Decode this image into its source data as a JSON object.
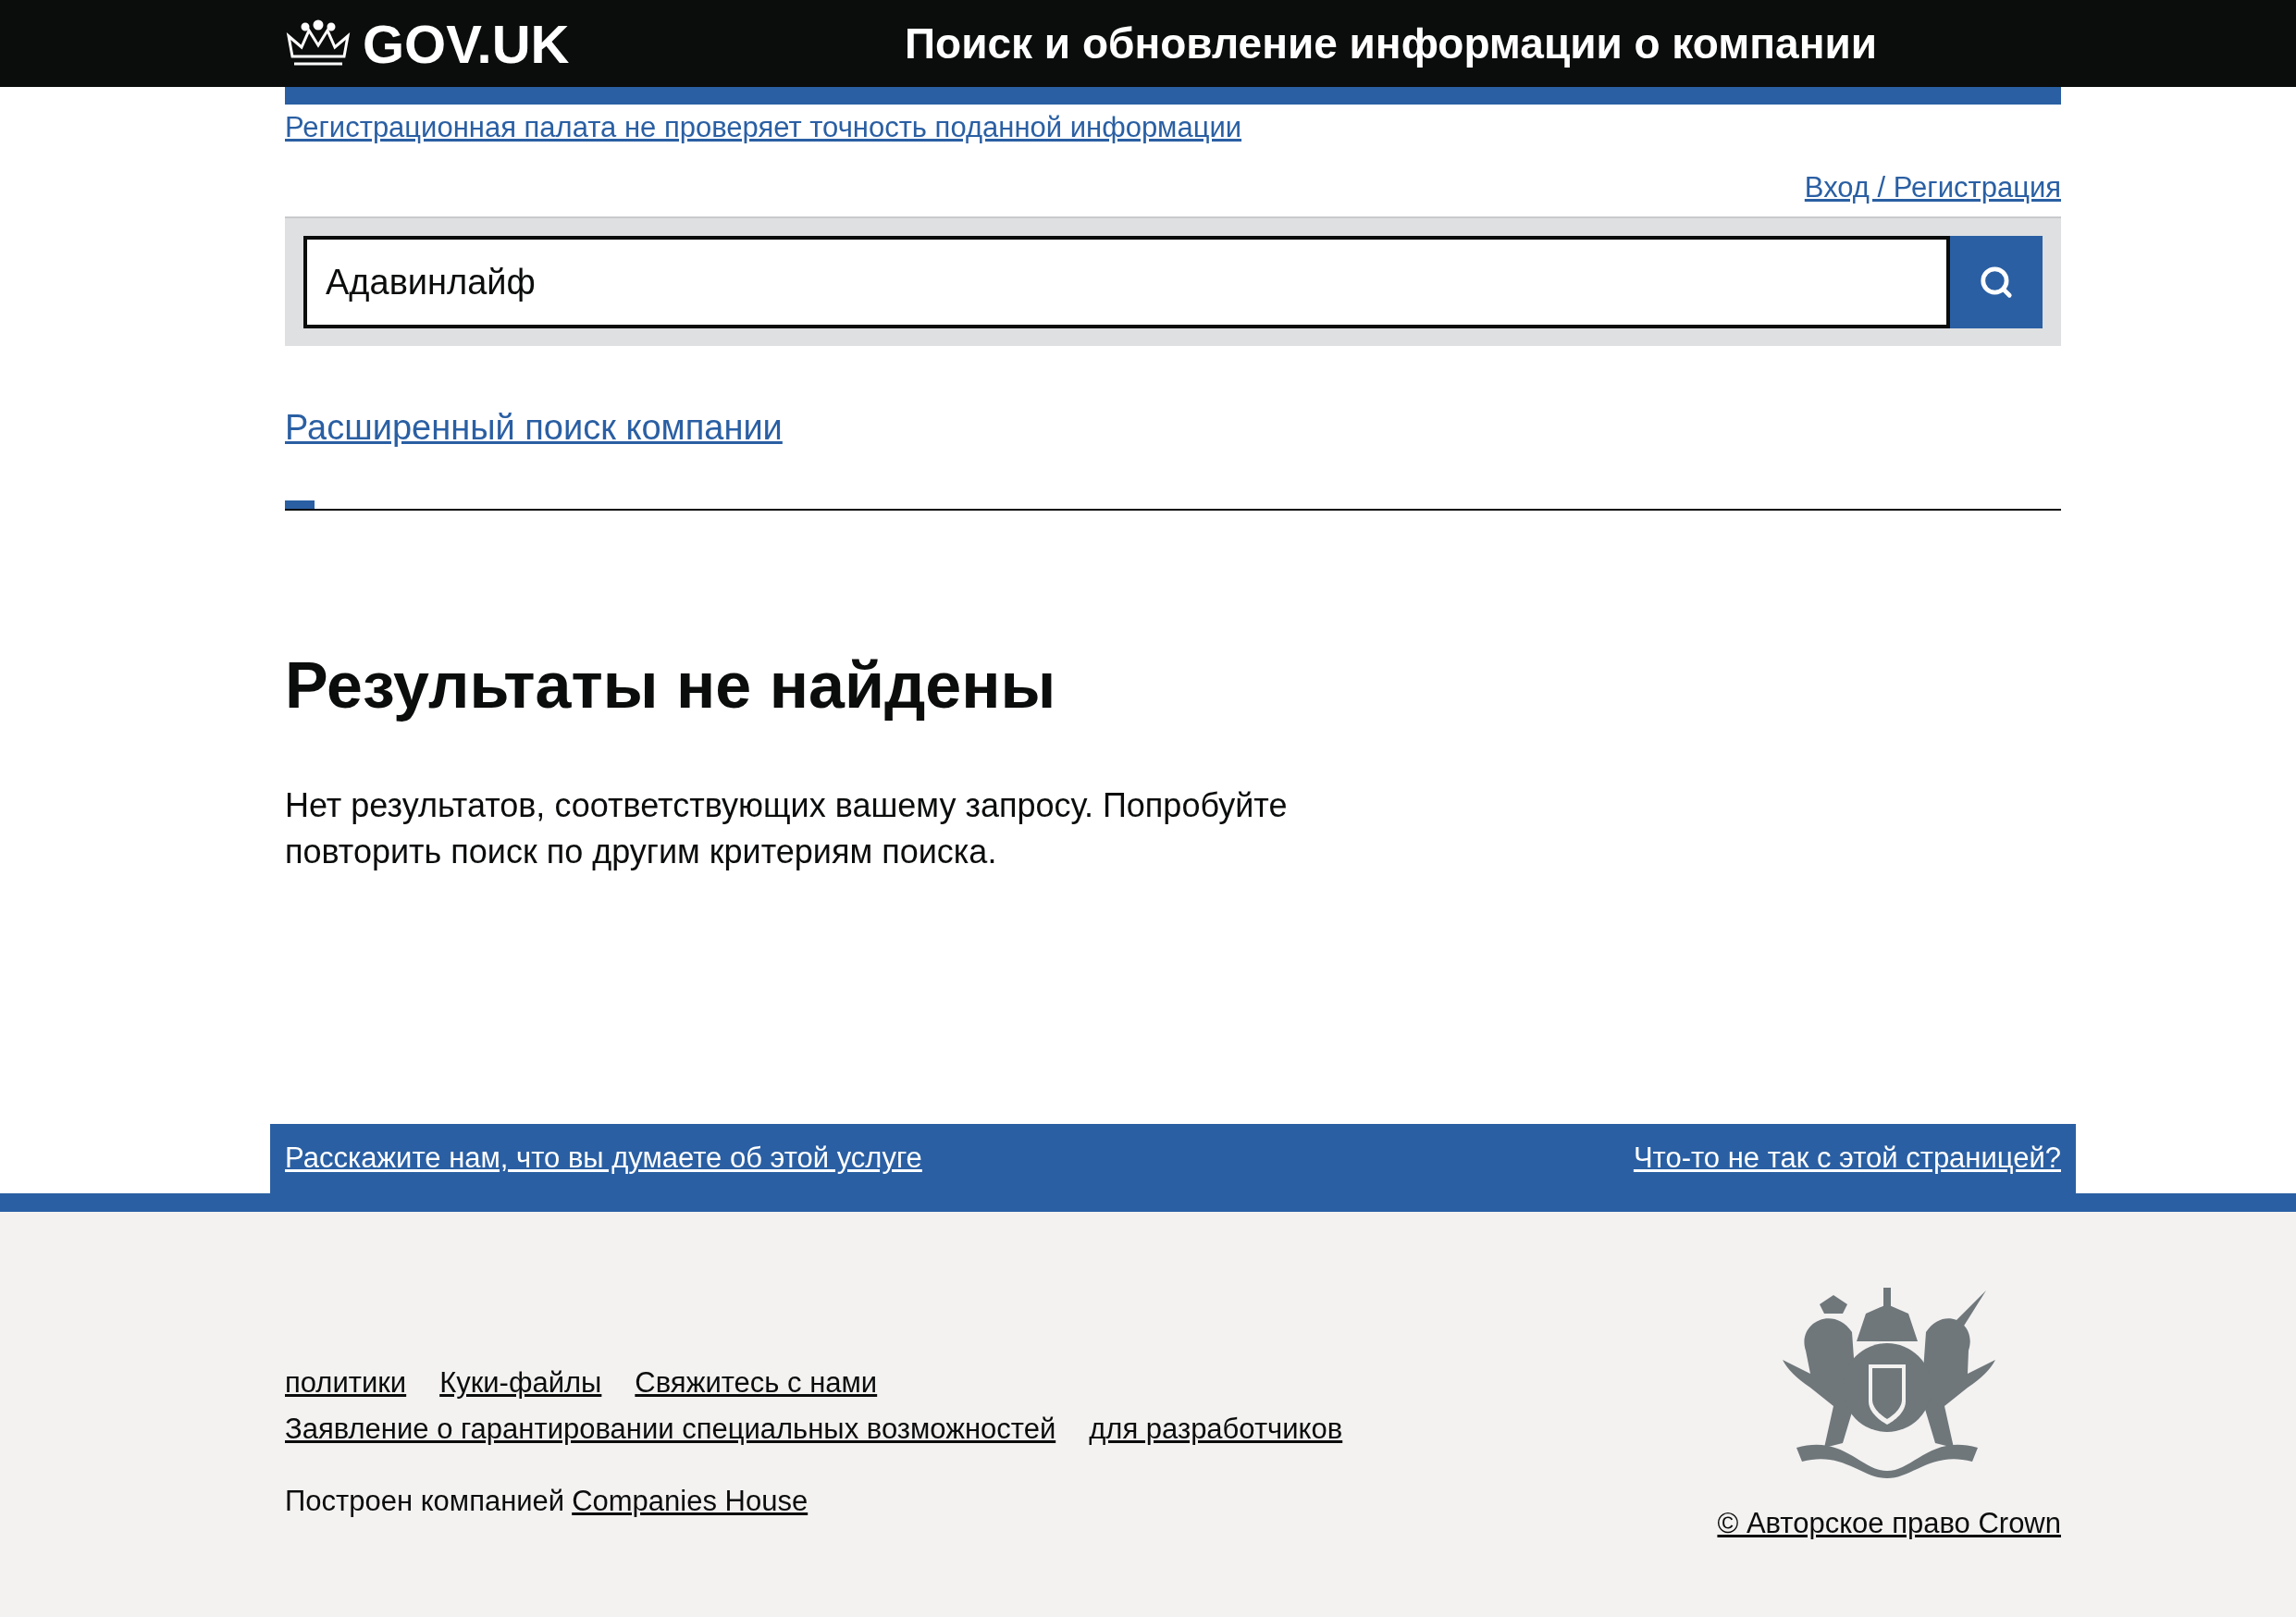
{
  "header": {
    "logo": "GOV.UK",
    "service_name": "Поиск и обновление информации о компании"
  },
  "notice_link": "Регистрационная палата не проверяет точность поданной информации",
  "sign_in_link": "Вход / Регистрация",
  "search": {
    "value": "Адавинлайф"
  },
  "advanced_search_link": "Расширенный поиск компании",
  "results": {
    "heading": "Результаты не найдены",
    "message": "Нет результатов, соответствующих вашему запросу. Попробуйте повторить поиск по другим критериям поиска."
  },
  "feedback_bar": {
    "left_link": "Расскажите нам, что вы думаете об этой услуге",
    "right_link": "Что-то не так с этой страницей?"
  },
  "footer": {
    "link_rows": [
      [
        "политики",
        "Куки-файлы",
        "Свяжитесь с нами"
      ],
      [
        "Заявление о гарантировании специальных возможностей",
        "для разработчиков"
      ]
    ],
    "built_by_text": "Построен компанией",
    "built_by_link": "Companies House",
    "copyright": "© Авторское право Crown"
  }
}
